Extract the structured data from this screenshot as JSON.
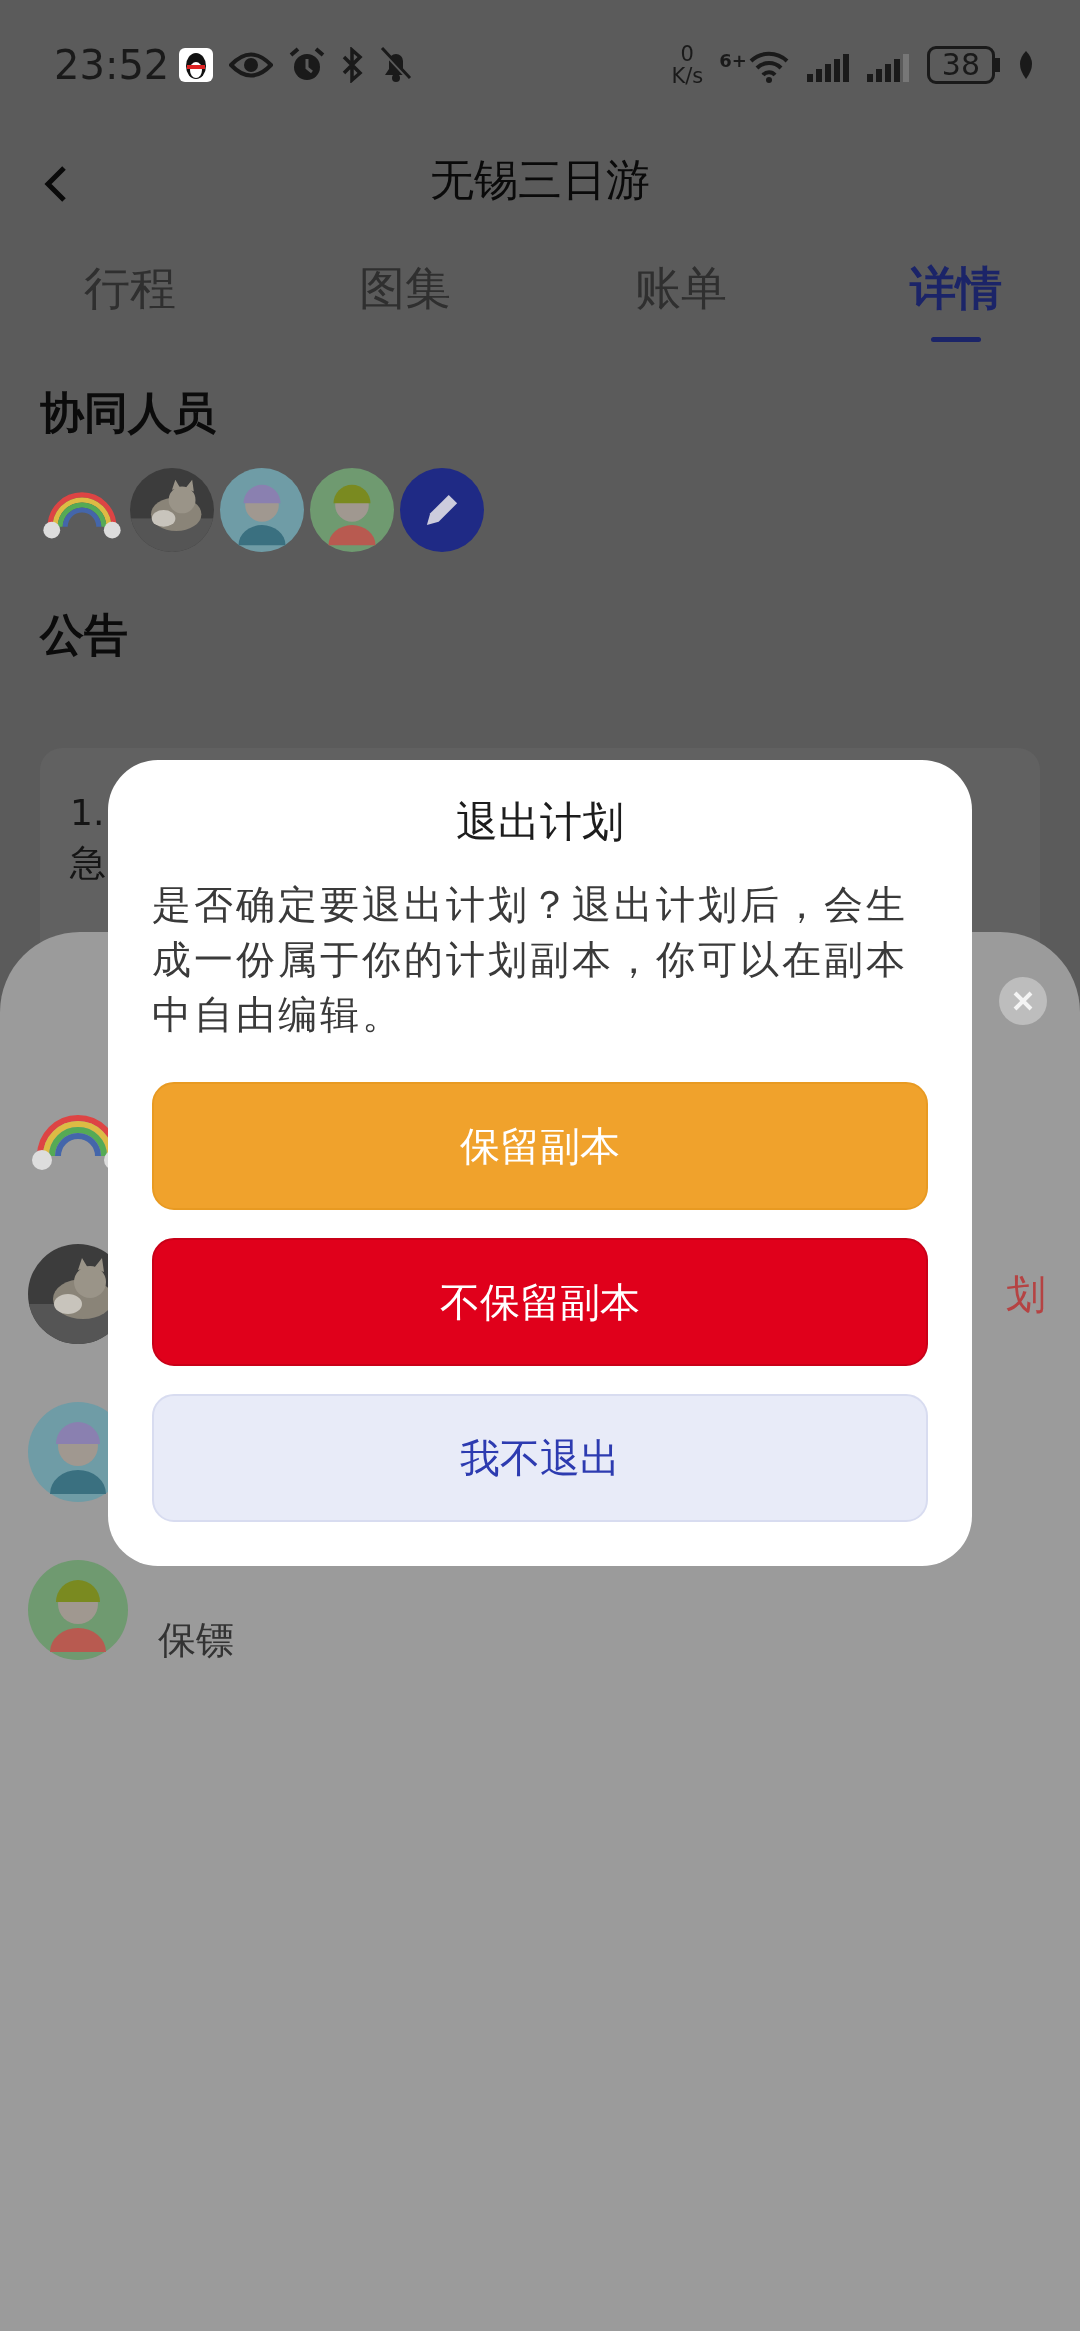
{
  "status_bar": {
    "time": "23:52",
    "net_speed_value": "0",
    "net_speed_unit": "K/s",
    "wifi_label": "6+",
    "battery": "38"
  },
  "header": {
    "title": "无锡三日游"
  },
  "tabs": [
    {
      "label": "行程",
      "selected": false
    },
    {
      "label": "图集",
      "selected": false
    },
    {
      "label": "账单",
      "selected": false
    },
    {
      "label": "详情",
      "selected": true
    }
  ],
  "collaborators": {
    "title": "协同人员",
    "avatars": [
      {
        "kind": "rainbow"
      },
      {
        "kind": "picture"
      },
      {
        "kind": "person",
        "color": "#6f9ca6"
      },
      {
        "kind": "person",
        "color": "#6f9a70"
      },
      {
        "kind": "edit"
      }
    ]
  },
  "notice": {
    "title": "公告",
    "lines": [
      "1.",
      "急"
    ]
  },
  "sheet": {
    "members": [
      {
        "kind": "rainbow"
      },
      {
        "kind": "picture",
        "action": "划"
      },
      {
        "kind": "person",
        "color": "#6f9ca6"
      },
      {
        "kind": "person",
        "color": "#6f9a70",
        "role": "保镖"
      }
    ]
  },
  "dialog": {
    "title": "退出计划",
    "message": "是否确定要退出计划？退出计划后，会生成一份属于你的计划副本，你可以在副本中自由编辑。",
    "buttons": [
      {
        "label": "保留副本",
        "kind": "keep"
      },
      {
        "label": "不保留副本",
        "kind": "discard"
      },
      {
        "label": "我不退出",
        "kind": "cancel"
      }
    ]
  }
}
